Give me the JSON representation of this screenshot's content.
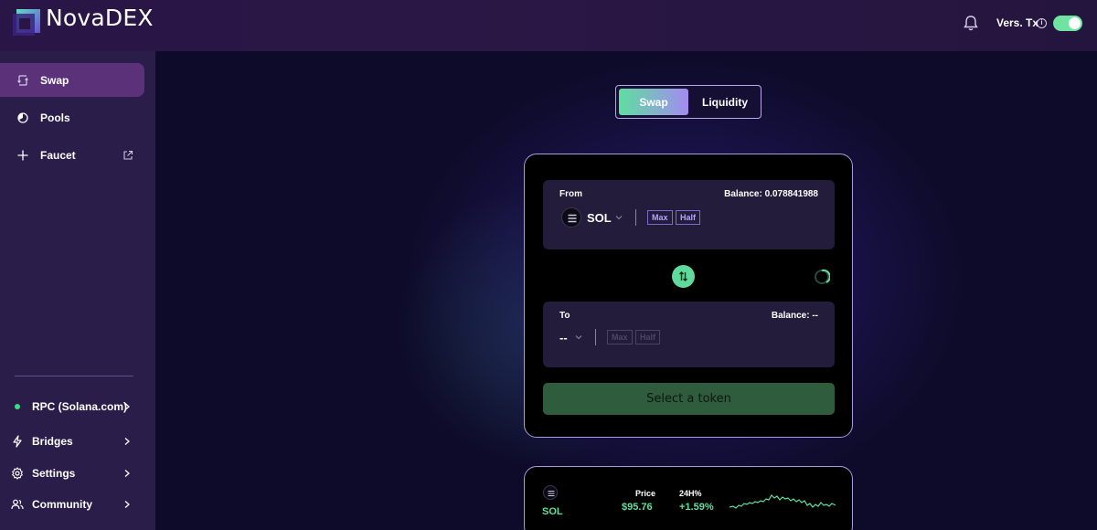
{
  "header": {
    "brand": "NovaDEX",
    "vers_tx_label": "Vers. Tx",
    "info_glyph": "i",
    "toggle_on": true,
    "icons": [
      "logo-icon",
      "bell-icon",
      "info-icon"
    ]
  },
  "sidebar": {
    "items": [
      {
        "label": "Swap",
        "icon": "swap-icon",
        "active": true
      },
      {
        "label": "Pools",
        "icon": "pools-icon",
        "active": false
      },
      {
        "label": "Faucet",
        "icon": "plus-icon",
        "active": false,
        "external": true
      }
    ],
    "bottom": [
      {
        "label": "RPC (Solana.com)",
        "icon": "status-dot",
        "status_color": "#36e07c"
      },
      {
        "label": "Bridges",
        "icon": "lightning-icon"
      },
      {
        "label": "Settings",
        "icon": "gear-icon"
      },
      {
        "label": "Community",
        "icon": "people-icon"
      }
    ]
  },
  "tabs": {
    "swap": "Swap",
    "liquidity": "Liquidity",
    "active": "swap"
  },
  "swap_card": {
    "from": {
      "label": "From",
      "balance": "Balance: 0.078841988",
      "token": "SOL",
      "max": "Max",
      "half": "Half"
    },
    "to": {
      "label": "To",
      "balance": "Balance: --",
      "token": "--",
      "max": "Max",
      "half": "Half"
    },
    "action": "Select a token"
  },
  "price_card": {
    "token": "SOL",
    "price_label": "Price",
    "price": "$95.76",
    "change_label": "24H%",
    "change": "+1.59%"
  },
  "colors": {
    "accent_green": "#5fe09c",
    "accent_purple": "#a48bf0",
    "active_nav": "#5b327a"
  }
}
